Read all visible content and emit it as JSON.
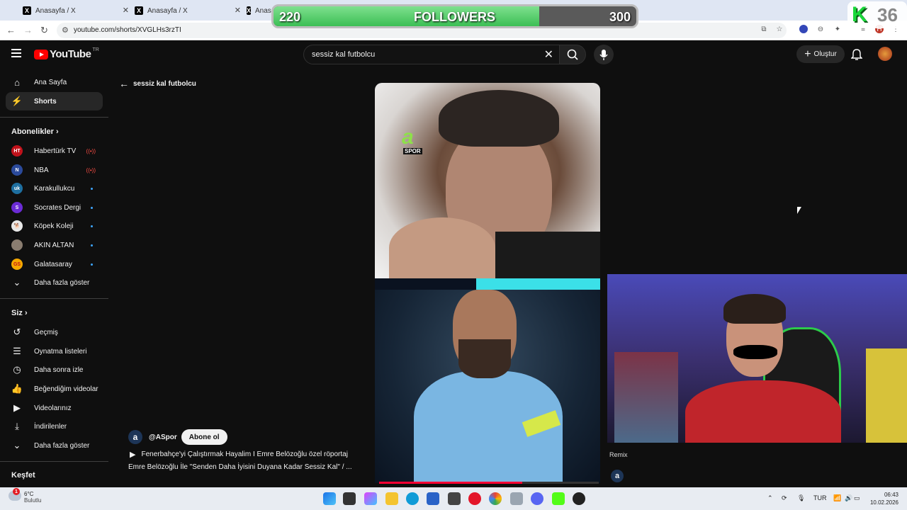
{
  "browser": {
    "tabs": [
      {
        "title": "Anasayfa / X"
      },
      {
        "title": "Anasayfa / X"
      },
      {
        "title": "Anas"
      }
    ],
    "url": "youtube.com/shorts/XVGLHs3rzTI"
  },
  "stream_overlay": {
    "followers_label": "FOLLOWERS",
    "current": "220",
    "goal": "300",
    "progress_fraction": 0.733,
    "badge_letter": "K",
    "badge_number": "36",
    "badge_color": "#19d83a"
  },
  "youtube": {
    "logo_text": "YouTube",
    "region": "TR",
    "search_value": "sessiz kal futbolcu",
    "create_label": "Oluştur",
    "brand_color": "#ff0000"
  },
  "sidebar": {
    "main": [
      {
        "label": "Ana Sayfa",
        "icon": "home-icon"
      },
      {
        "label": "Shorts",
        "icon": "shorts-icon"
      }
    ],
    "subscriptions_header": "Abonelikler",
    "subscriptions": [
      {
        "label": "Habertürk TV",
        "color": "#c0121b",
        "status": "live"
      },
      {
        "label": "NBA",
        "color": "#2b4a9b",
        "status": "live"
      },
      {
        "label": "Karakullukcu",
        "color": "#1e6fa0",
        "status": "new"
      },
      {
        "label": "Socrates Dergi",
        "color": "#6b2bd6",
        "status": "new"
      },
      {
        "label": "Köpek Koleji",
        "color": "#e8e8e8",
        "status": "new"
      },
      {
        "label": "AKIN ALTAN",
        "color": "#8a7d70",
        "status": "new"
      },
      {
        "label": "Galatasaray",
        "color": "#f5a800",
        "status": "new"
      }
    ],
    "show_more_1": "Daha fazla göster",
    "you_header": "Siz",
    "you": [
      {
        "label": "Geçmiş",
        "icon": "history-icon"
      },
      {
        "label": "Oynatma listeleri",
        "icon": "playlist-icon"
      },
      {
        "label": "Daha sonra izle",
        "icon": "clock-icon"
      },
      {
        "label": "Beğendiğim videolar",
        "icon": "like-icon"
      },
      {
        "label": "Videolarınız",
        "icon": "video-icon"
      },
      {
        "label": "İndirilenler",
        "icon": "download-icon"
      }
    ],
    "show_more_2": "Daha fazla göster",
    "explore_header": "Keşfet"
  },
  "short": {
    "back_label": "sessiz kal futbolcu",
    "channel_name": "@ASpor",
    "subscribe_label": "Abone ol",
    "title": "Fenerbahçe'yi Çalıştırmak Hayalim I Emre Belözoğlu özel röportaj",
    "description": "Emre Belözoğlu İle \"Senden Daha İyisini Duyana Kadar Sessiz Kal\" / ...",
    "watermark_letter": "a",
    "watermark_sub": "SPOR",
    "avatar_letter": "a",
    "progress_fraction": 0.65,
    "remix_label": "Remix"
  },
  "taskbar": {
    "weather_temp": "6°C",
    "weather_desc": "Bulutlu",
    "weather_alert": "1",
    "lang": "TUR",
    "time": "06:43",
    "date": "10.02.2026"
  }
}
